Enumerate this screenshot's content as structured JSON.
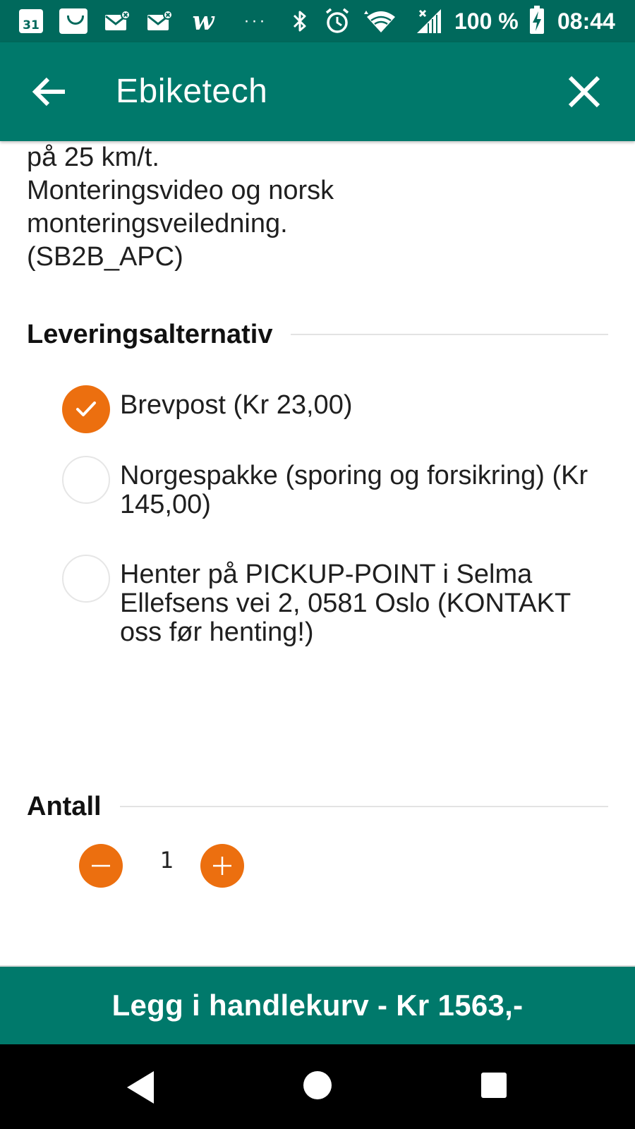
{
  "status_bar": {
    "calendar_day": "31",
    "battery_percent": "100 %",
    "time": "08:44",
    "more_indicator": "···",
    "w_icon_glyph": "w"
  },
  "app_bar": {
    "title": "Ebiketech",
    "back_icon": "arrow-left-icon",
    "close_icon": "close-icon"
  },
  "description_lines": [
    "på 25 km/t.",
    "Monteringsvideo og norsk",
    "monteringsveiledning.",
    "(SB2B_APC)"
  ],
  "delivery": {
    "heading": "Leveringsalternativ",
    "options": [
      {
        "label": "Brevpost (Kr 23,00)",
        "selected": true
      },
      {
        "label": "Norgespakke (sporing og forsikring) (Kr 145,00)",
        "selected": false
      },
      {
        "label": "Henter på PICKUP-POINT i Selma Ellefsens vei 2, 0581 Oslo (KONTAKT oss før henting!)",
        "selected": false
      }
    ]
  },
  "quantity": {
    "heading": "Antall",
    "value": "1"
  },
  "cart_button": {
    "label": "Legg i handlekurv - Kr 1563,-"
  },
  "colors": {
    "status_bar": "#00695c",
    "app_bar": "#00796b",
    "accent_orange": "#ec6f0f",
    "divider": "#e3e3e3"
  }
}
